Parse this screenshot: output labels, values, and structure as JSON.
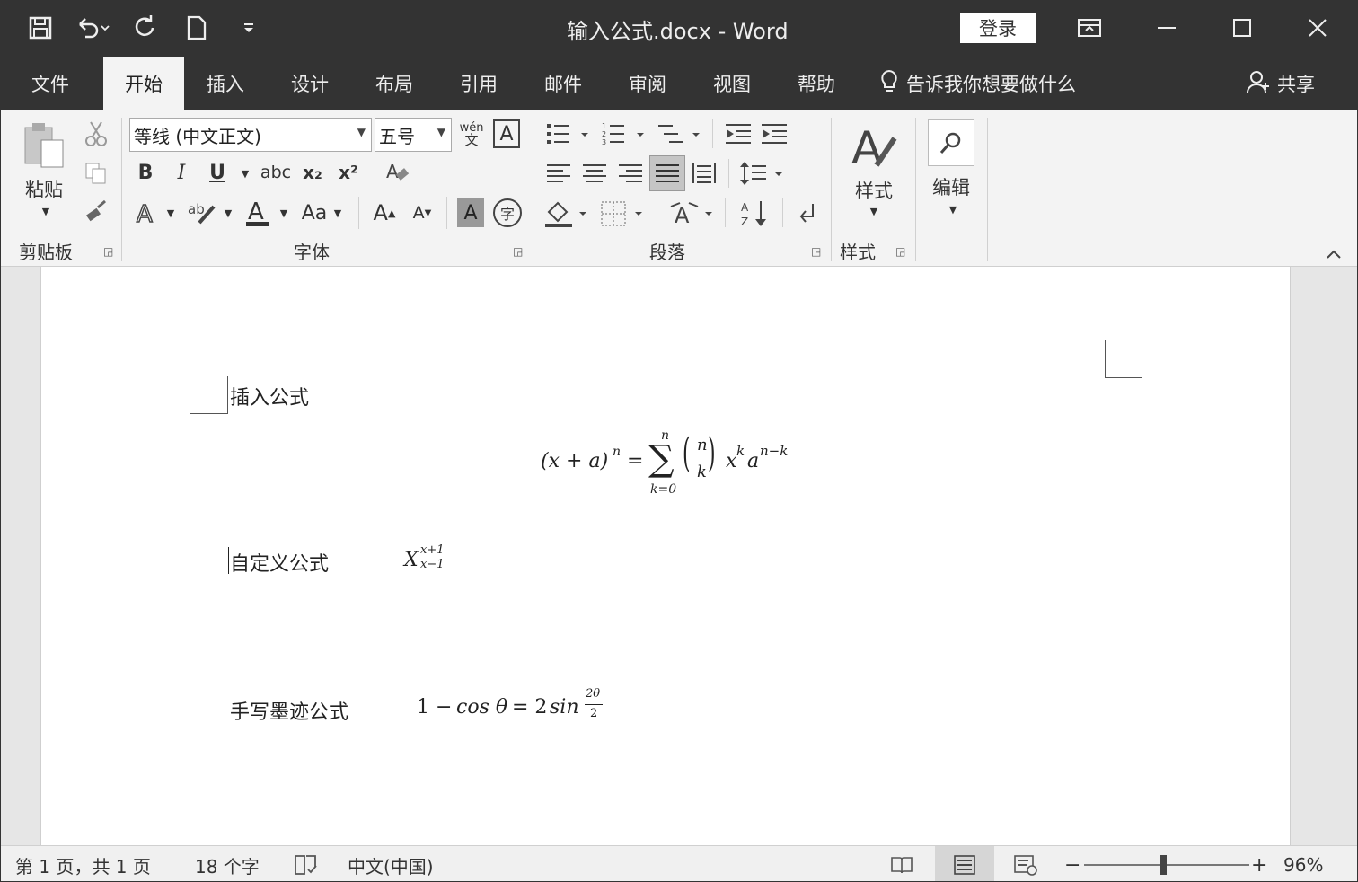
{
  "title_bar": {
    "document_title": "输入公式.docx  -  Word",
    "login_label": "登录",
    "qat": [
      "save-icon",
      "undo-icon",
      "redo-icon",
      "new-doc-icon",
      "customize-qat-icon"
    ],
    "window_controls": [
      "ribbon-display-icon",
      "minimize-icon",
      "maximize-icon",
      "close-icon"
    ]
  },
  "tabs": {
    "items": [
      "文件",
      "开始",
      "插入",
      "设计",
      "布局",
      "引用",
      "邮件",
      "审阅",
      "视图",
      "帮助"
    ],
    "active": "开始",
    "tell_me": "告诉我你想要做什么",
    "share": "共享"
  },
  "ribbon": {
    "clipboard": {
      "label": "剪贴板",
      "paste_label": "粘贴"
    },
    "font": {
      "label": "字体",
      "font_name": "等线 (中文正文)",
      "font_size": "五号",
      "bold": "B",
      "italic": "I",
      "underline": "U",
      "strike": "abc",
      "subscript": "x₂",
      "superscript": "x²",
      "case": "Aa",
      "grow": "A",
      "shrink": "A",
      "phonetic_top": "wén",
      "phonetic_bottom": "文",
      "char_border": "A",
      "enclose": "字",
      "char_shade": "A"
    },
    "paragraph": {
      "label": "段落"
    },
    "styles": {
      "label": "样式",
      "button_label": "样式"
    },
    "editing": {
      "button_label": "编辑"
    }
  },
  "document": {
    "line1": "插入公式",
    "line2": "自定义公式",
    "line3": "手写墨迹公式"
  },
  "status_bar": {
    "page": "第 1 页，共 1 页",
    "words": "18 个字",
    "language": "中文(中国)",
    "zoom": "96%"
  },
  "colors": {
    "titlebar": "#333333",
    "ribbon": "#f3f3f3",
    "workspace": "#e6e6e6"
  }
}
